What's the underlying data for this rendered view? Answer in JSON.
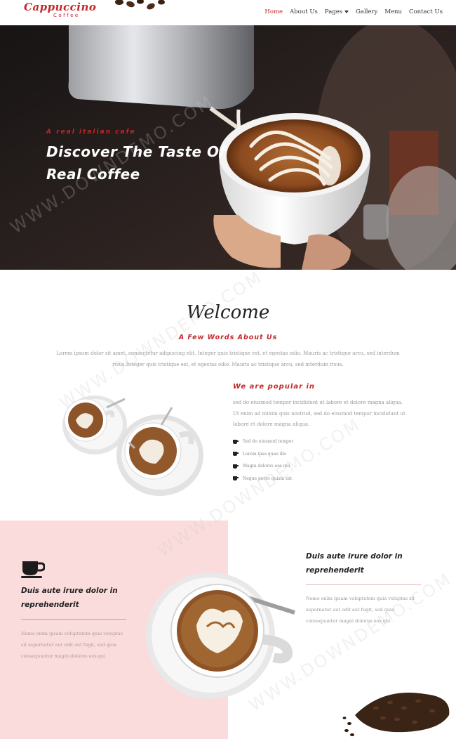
{
  "nav": {
    "logo_main": "Cappuccino",
    "logo_sub": "Coffee",
    "items": [
      {
        "label": "Home",
        "active": true
      },
      {
        "label": "About Us"
      },
      {
        "label": "Pages",
        "dropdown": true
      },
      {
        "label": "Gallery"
      },
      {
        "label": "Menu"
      },
      {
        "label": "Contact Us"
      }
    ]
  },
  "hero": {
    "kicker": "A real italian cafe",
    "title": "Discover The Taste Of Real Coffee"
  },
  "welcome": {
    "title": "Welcome",
    "subtitle": "A Few Words About Us",
    "text": "Lorem ipsum dolor sit amet, consectetur adipiscing elit. Integer quis tristique est, et egestas odio. Mauris ac tristique arcu, sed interdum risus.Integer quis tristique est, et egestas odio. Mauris ac tristique arcu, sed interdum risus."
  },
  "popular": {
    "title": "We are popular in",
    "text": "sed do eiusmod tempor incididunt ut labore et dolore magna aliqua. Ut enim ad minim quis nostrud, sed do eiusmod tempor incididunt ut labore et dolore magna aliqua.",
    "items": [
      "Sed do eiusmod tempor",
      "Lorem ipsa quae illo",
      "Magni dolores eos qui",
      "Neque porro quism est"
    ]
  },
  "feature_left": {
    "icon": "coffee-cup-icon",
    "heading": "Duis aute irure dolor in reprehenderit",
    "text": "Nemo enim ipsam voluptatem quia voluptas sit aspernatur aut odit aut fugit, sed quia consequuntur magni dolores eos qui"
  },
  "feature_right": {
    "heading": "Duis aute irure dolor in reprehenderit",
    "text": "Nemo enim ipsam voluptatem quia voluptas sit aspernatur aut odit aut fugit, sed quia consequuntur magni dolores eos qui"
  },
  "watermark": "WWW.DOWNDEMO.COM",
  "colors": {
    "accent": "#c3272b",
    "pink_panel": "#fbdcdc",
    "text_muted": "#9a9a9a"
  }
}
